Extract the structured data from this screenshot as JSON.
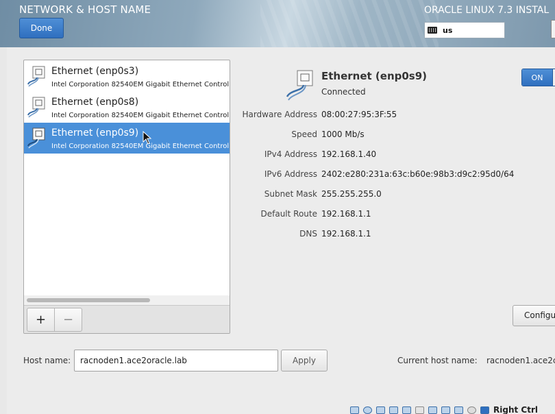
{
  "header": {
    "title": "NETWORK & HOST NAME",
    "product": "ORACLE LINUX 7.3 INSTAL",
    "done_label": "Done",
    "keyboard_layout": "us"
  },
  "devices": {
    "items": [
      {
        "name": "Ethernet (enp0s3)",
        "description": "Intel Corporation 82540EM Gigabit Ethernet Controll",
        "selected": false
      },
      {
        "name": "Ethernet (enp0s8)",
        "description": "Intel Corporation 82540EM Gigabit Ethernet Controll",
        "selected": false
      },
      {
        "name": "Ethernet (enp0s9)",
        "description": "Intel Corporation 82540EM Gigabit Ethernet Controll",
        "selected": true
      }
    ],
    "add_label": "+",
    "remove_label": "−"
  },
  "detail": {
    "name": "Ethernet (enp0s9)",
    "status": "Connected",
    "toggle_label": "ON",
    "properties": [
      {
        "label": "Hardware Address",
        "value": "08:00:27:95:3F:55"
      },
      {
        "label": "Speed",
        "value": "1000 Mb/s"
      },
      {
        "label": "IPv4 Address",
        "value": "192.168.1.40"
      },
      {
        "label": "IPv6 Address",
        "value": "2402:e280:231a:63c:b60e:98b3:d9c2:95d0/64"
      },
      {
        "label": "Subnet Mask",
        "value": "255.255.255.0"
      },
      {
        "label": "Default Route",
        "value": "192.168.1.1"
      },
      {
        "label": "DNS",
        "value": "192.168.1.1"
      }
    ],
    "configure_label": "Configu"
  },
  "hostname": {
    "label": "Host name:",
    "value": "racnoden1.ace2oracle.lab",
    "apply_label": "Apply",
    "current_label": "Current host name:",
    "current_value": "racnoden1.ace2c"
  },
  "statusbar": {
    "host_key": "Right Ctrl"
  },
  "colors": {
    "accent": "#4a90d9",
    "button_blue": "#2f6fbf"
  }
}
